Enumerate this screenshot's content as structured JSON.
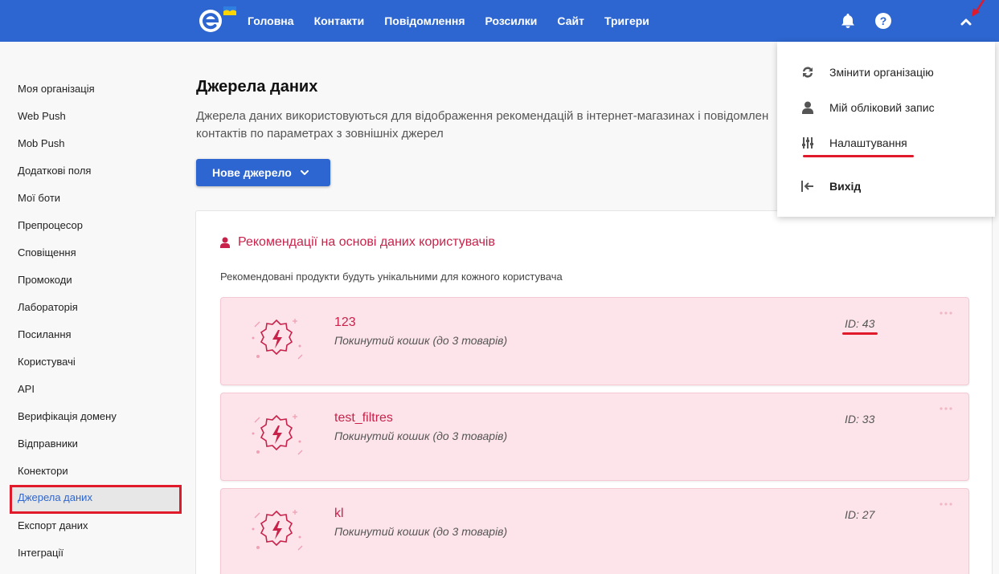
{
  "nav": {
    "items": [
      "Головна",
      "Контакти",
      "Повідомлення",
      "Розсилки",
      "Сайт",
      "Тригери"
    ]
  },
  "sidebar": {
    "items": [
      {
        "label": "Моя організація"
      },
      {
        "label": "Web Push"
      },
      {
        "label": "Mob Push"
      },
      {
        "label": "Додаткові поля"
      },
      {
        "label": "Мої боти"
      },
      {
        "label": "Препроцесор"
      },
      {
        "label": "Сповіщення"
      },
      {
        "label": "Промокоди"
      },
      {
        "label": "Лабораторія"
      },
      {
        "label": "Посилання"
      },
      {
        "label": "Користувачі"
      },
      {
        "label": "API"
      },
      {
        "label": "Верифікація домену"
      },
      {
        "label": "Відправники"
      },
      {
        "label": "Конектори"
      },
      {
        "label": "Джерела даних",
        "active": true
      },
      {
        "label": "Експорт даних"
      },
      {
        "label": "Інтеграції"
      }
    ]
  },
  "main": {
    "title": "Джерела даних",
    "description": "Джерела даних використовуються для відображення рекомендацій в інтернет-магазинах і повідомлен контактів по параметрах з зовнішніх джерел",
    "new_button": "Нове джерело",
    "panel": {
      "title": "Рекомендації на основі даних користувачів",
      "subtitle": "Рекомендовані продукти будуть унікальними для кожного користувача",
      "cards": [
        {
          "name": "123",
          "description": "Покинутий кошик (до 3 товарів)",
          "id": "ID: 43"
        },
        {
          "name": "test_filtres",
          "description": "Покинутий кошик (до 3 товарів)",
          "id": "ID: 33"
        },
        {
          "name": "kl",
          "description": "Покинутий кошик (до 3 товарів)",
          "id": "ID: 27"
        }
      ]
    }
  },
  "dropdown": {
    "items": [
      {
        "label": "Змінити організацію",
        "icon": "refresh-icon"
      },
      {
        "label": "Мій обліковий запис",
        "icon": "user-icon"
      },
      {
        "label": "Налаштування",
        "icon": "sliders-icon"
      },
      {
        "label": "Вихід",
        "icon": "logout-icon"
      }
    ]
  },
  "colors": {
    "topbar": "#2d66d0",
    "accent": "#c8224a",
    "card_bg": "#fde4ea",
    "highlight": "#e0192b"
  }
}
